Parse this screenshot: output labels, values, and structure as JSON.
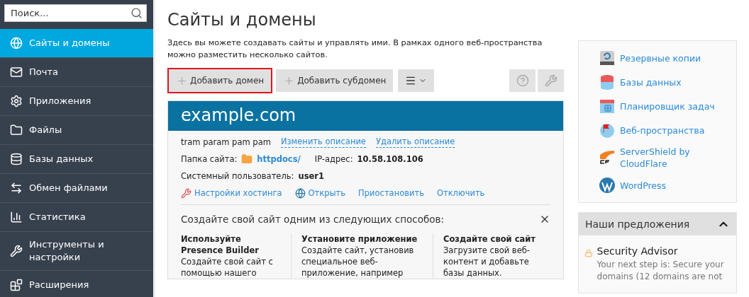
{
  "sidebar": {
    "search": {
      "placeholder": "Поиск..."
    },
    "items": [
      {
        "label": "Сайты и домены",
        "selected": true
      },
      {
        "label": "Почта",
        "selected": false
      },
      {
        "label": "Приложения",
        "selected": false
      },
      {
        "label": "Файлы",
        "selected": false
      },
      {
        "label": "Базы данных",
        "selected": false
      },
      {
        "label": "Обмен файлами",
        "selected": false
      },
      {
        "label": "Статистика",
        "selected": false
      },
      {
        "label": "Инструменты и настройки",
        "selected": false
      },
      {
        "label": "Расширения",
        "selected": false
      }
    ]
  },
  "page": {
    "title": "Сайты и домены",
    "description": "Здесь вы можете создавать сайты и управлять ими. В рамках одного веб-пространства можно разместить несколько сайтов.",
    "toolbar": [
      {
        "label": "Добавить домен",
        "highlighted": true
      },
      {
        "label": "Добавить субдомен",
        "highlighted": false
      }
    ]
  },
  "domain": {
    "name": "example.com",
    "description": "tram param pam pam",
    "description_links": [
      "Изменить описание",
      "Удалить описание"
    ],
    "folder_label": "Папка сайта:",
    "folder": "httpdocs/",
    "ip_label": "IP-адрес:",
    "ip": "10.58.108.106",
    "user_label": "Системный пользователь:",
    "user": "user1",
    "actions": [
      "Настройки хостинга",
      "Открыть",
      "Приостановить",
      "Отключить"
    ],
    "create": {
      "title": "Создайте свой сайт одним из следующих способов:",
      "options": [
        {
          "title": "Используйте Presence Builder",
          "text": "Создайте свой сайт с помощью нашего"
        },
        {
          "title": "Установите приложение",
          "text": "Создайте сайт, установив специальное веб-приложение, например"
        },
        {
          "title": "Создайте свой сайт",
          "text": "Загрузите свой веб-контент и добавьте базы данных."
        }
      ]
    }
  },
  "links": [
    "Резервные копии",
    "Базы данных",
    "Планировщик задач",
    "Веб-пространства",
    "ServerShield by CloudFlare",
    "WordPress"
  ],
  "offers": {
    "title": "Наши предложения",
    "expanded": true,
    "items": [
      {
        "title": "Security Advisor",
        "text": "Your next step is: Secure your domains (12 domains are not"
      }
    ]
  }
}
